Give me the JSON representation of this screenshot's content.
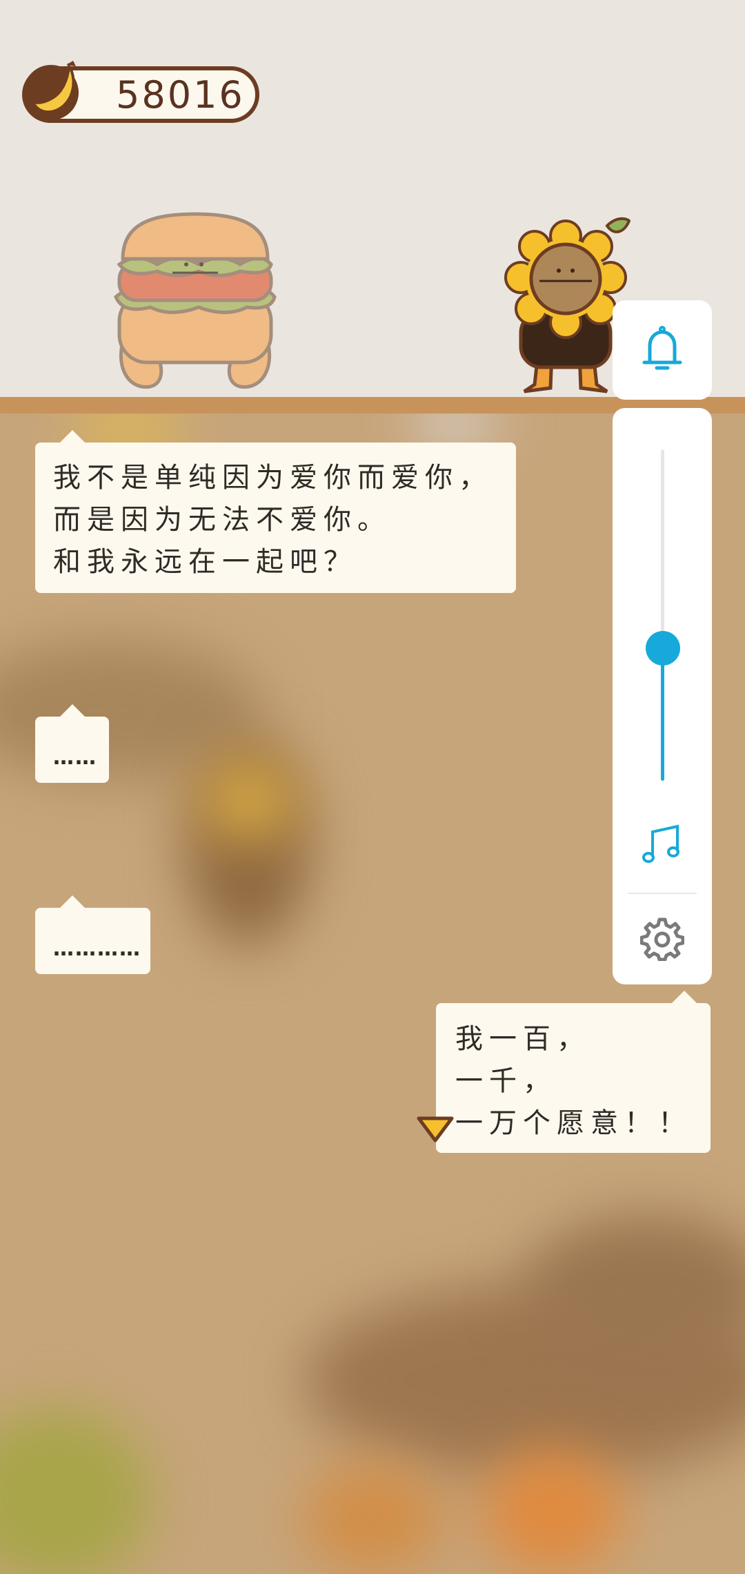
{
  "currency": {
    "banana_count": "58016"
  },
  "dialogue": [
    {
      "lines": [
        "我不是单纯因为爱你而爱你，",
        "而是因为无法不爱你。",
        "和我永远在一起吧？"
      ]
    },
    {
      "lines": [
        "……"
      ]
    },
    {
      "lines": [
        "…………"
      ]
    },
    {
      "lines": [
        "我一百，",
        "一千，",
        "一万个愿意！！"
      ]
    }
  ],
  "volume": {
    "level_percent": 40
  },
  "colors": {
    "accent": "#16a9d9",
    "bubble": "#fdf9ee",
    "shelf": "#c8935b",
    "counter_border": "#6d3d22"
  },
  "icons": [
    "banana-icon",
    "bell-icon",
    "music-note-icon",
    "gear-icon",
    "continue-arrow-icon"
  ]
}
